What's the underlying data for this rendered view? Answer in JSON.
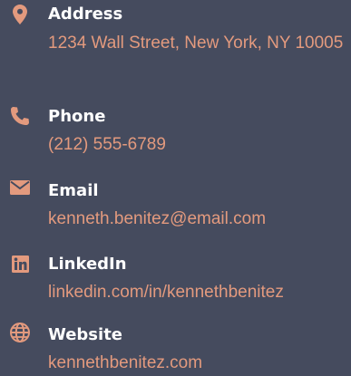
{
  "colors": {
    "background": "#454b5e",
    "accent": "#e39a7e",
    "label": "#ffffff"
  },
  "contacts": [
    {
      "icon": "map-marker-icon",
      "label": "Address",
      "value": "1234 Wall Street, New York, NY 10005"
    },
    {
      "icon": "phone-icon",
      "label": "Phone",
      "value": "(212) 555-6789"
    },
    {
      "icon": "envelope-icon",
      "label": "Email",
      "value": "kenneth.benitez@email.com"
    },
    {
      "icon": "linkedin-icon",
      "label": "LinkedIn",
      "value": "linkedin.com/in/kennethbenitez"
    },
    {
      "icon": "globe-icon",
      "label": "Website",
      "value": "kennethbenitez.com"
    }
  ]
}
